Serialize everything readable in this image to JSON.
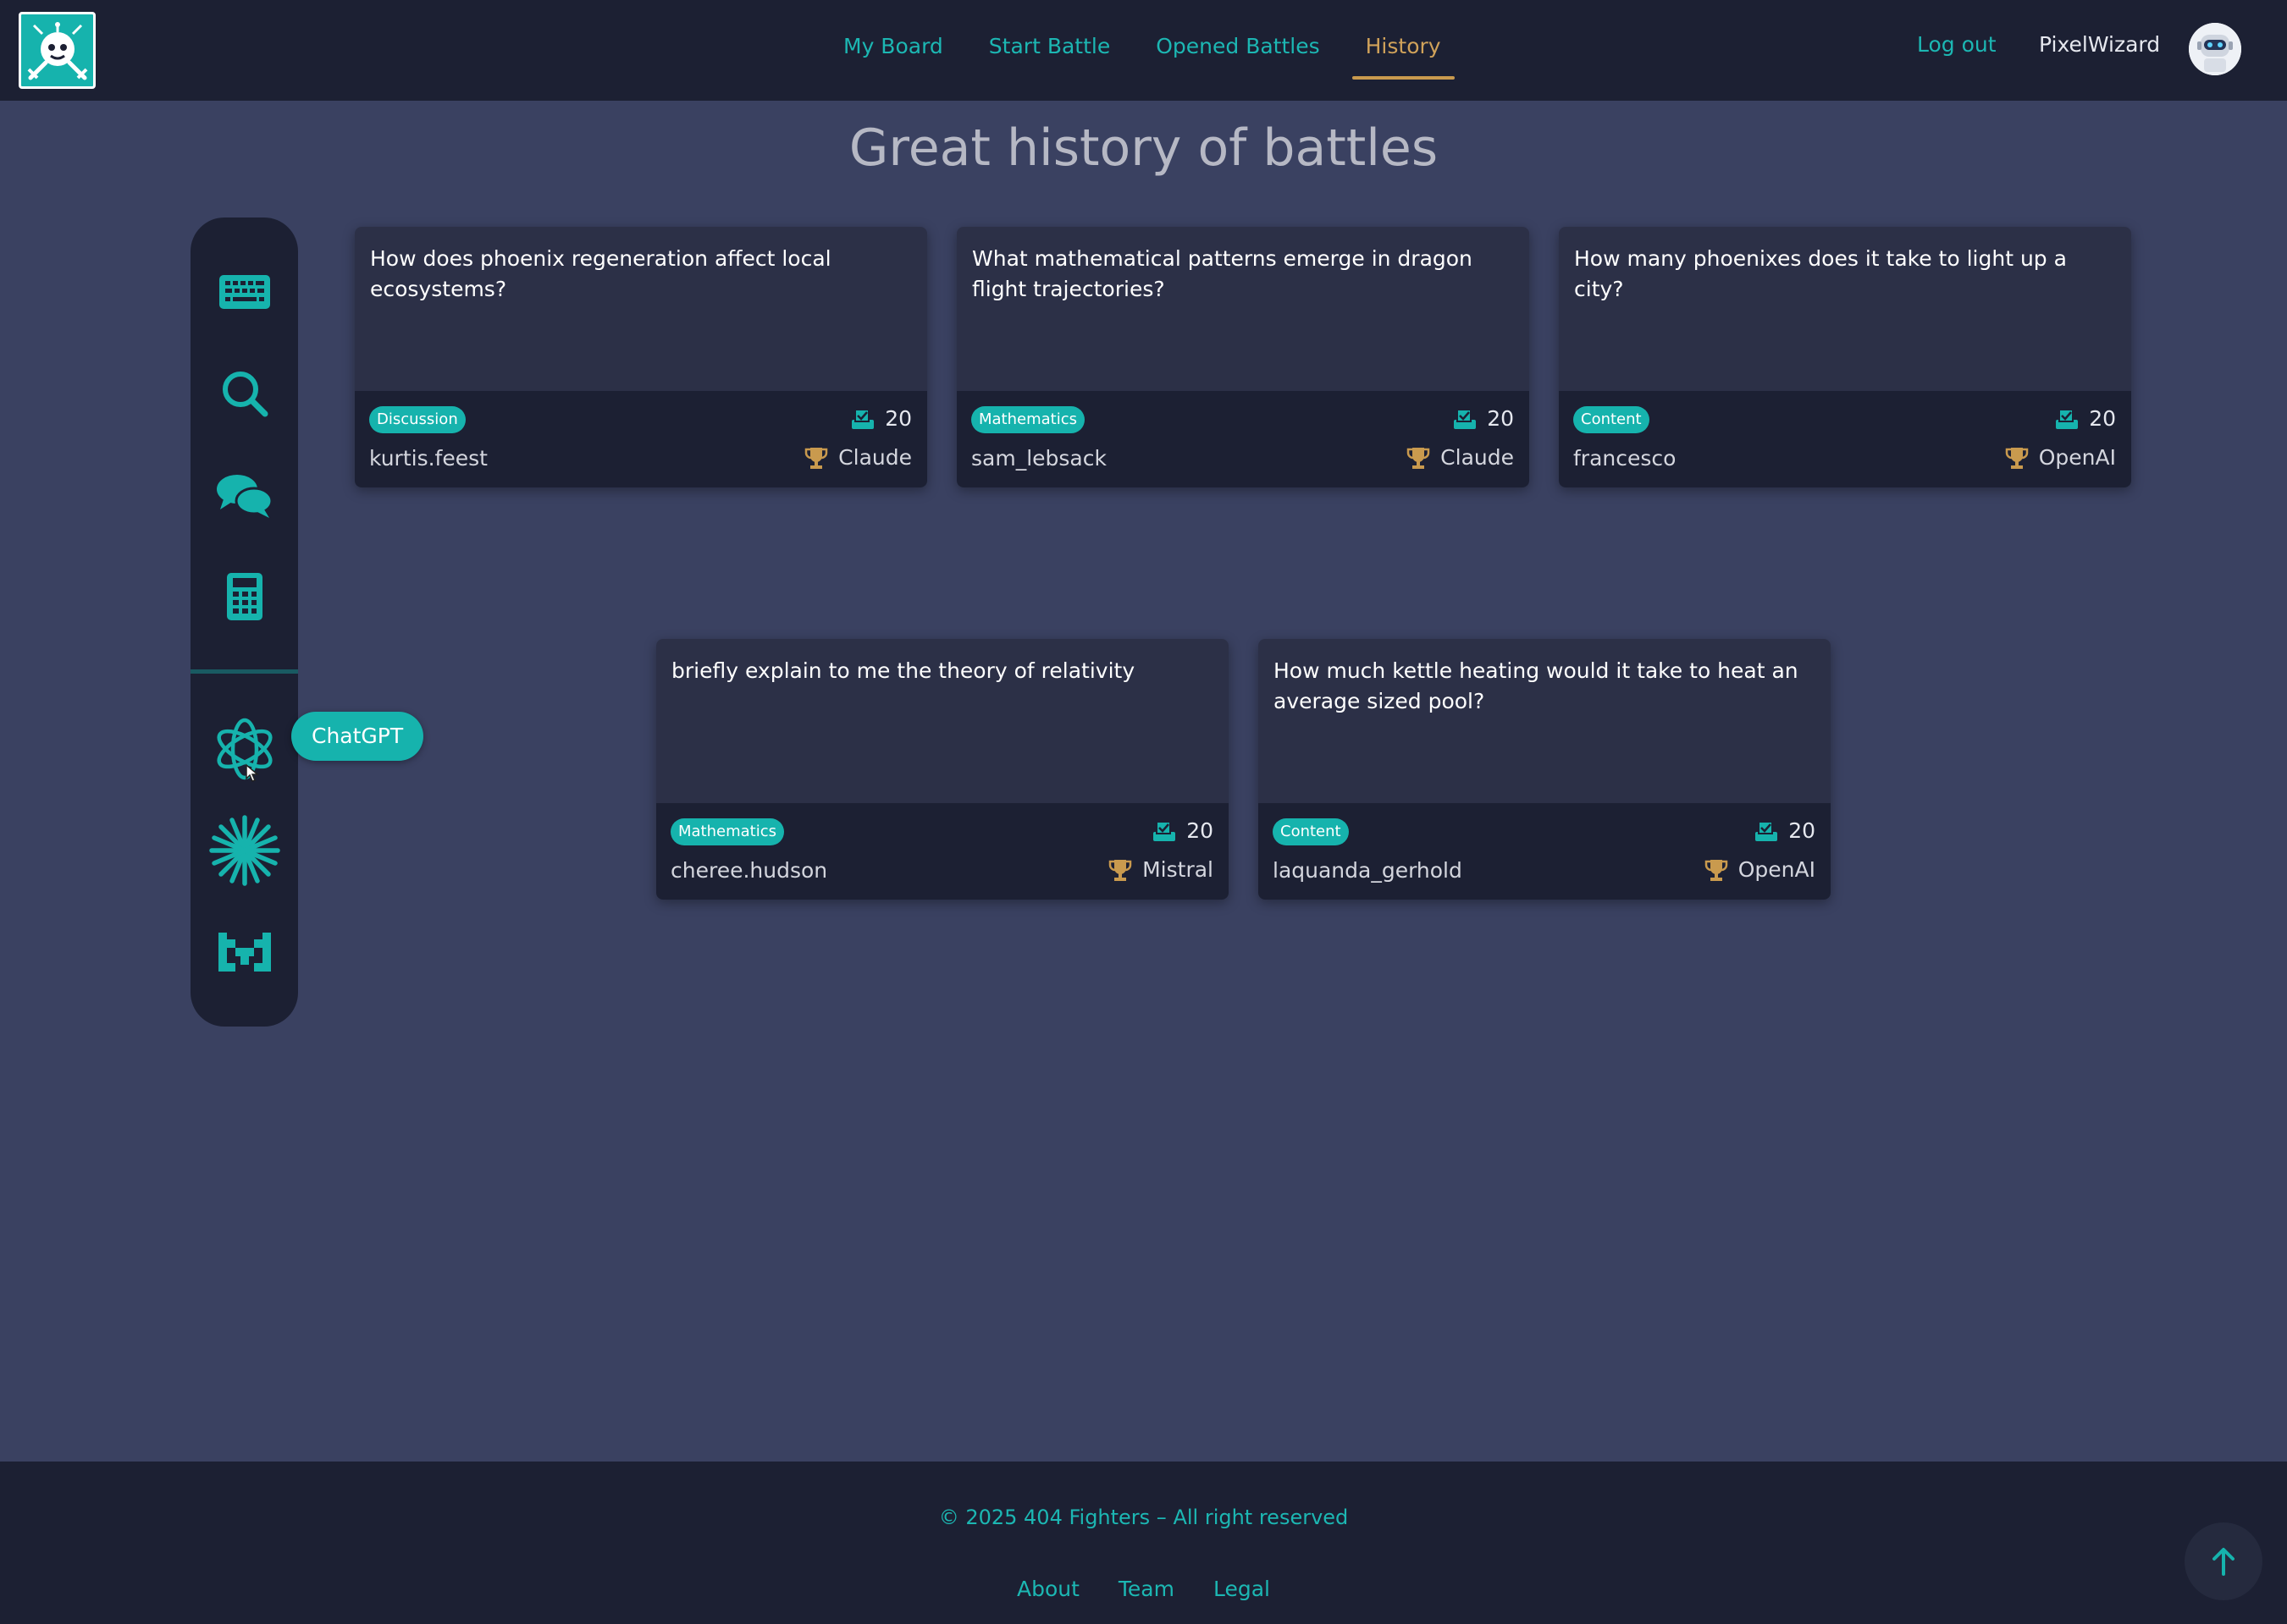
{
  "header": {
    "nav": [
      "My Board",
      "Start Battle",
      "Opened Battles",
      "History"
    ],
    "active": "History",
    "logout": "Log out",
    "username": "PixelWizard"
  },
  "title": "Great history of battles",
  "sidebar": {
    "icons": [
      "keyboard-icon",
      "search-icon",
      "chat-icon",
      "calculator-icon",
      "chatgpt-icon",
      "claude-icon",
      "mistral-icon"
    ],
    "tooltip": "ChatGPT"
  },
  "battles": [
    {
      "question": "How does phoenix regeneration affect local ecosystems?",
      "category": "Discussion",
      "votes": "20",
      "author": "kurtis.feest",
      "winner": "Claude"
    },
    {
      "question": "What mathematical patterns emerge in dragon flight trajectories?",
      "category": "Mathematics",
      "votes": "20",
      "author": "sam_lebsack",
      "winner": "Claude"
    },
    {
      "question": "How many phoenixes does it take to light up a city?",
      "category": "Content",
      "votes": "20",
      "author": "francesco",
      "winner": "OpenAI"
    },
    {
      "question": "briefly explain to me the theory of relativity",
      "category": "Mathematics",
      "votes": "20",
      "author": "cheree.hudson",
      "winner": "Mistral"
    },
    {
      "question": "How much kettle heating would it take to heat an average sized pool?",
      "category": "Content",
      "votes": "20",
      "author": "laquanda_gerhold",
      "winner": "OpenAI"
    }
  ],
  "footer": {
    "copyright": "© 2025 404 Fighters – All right reserved",
    "links": [
      "About",
      "Team",
      "Legal"
    ]
  },
  "colors": {
    "accent": "#16b3ad",
    "gold": "#c99a4e",
    "bg": "#3a4161",
    "panel": "#1c2033"
  }
}
